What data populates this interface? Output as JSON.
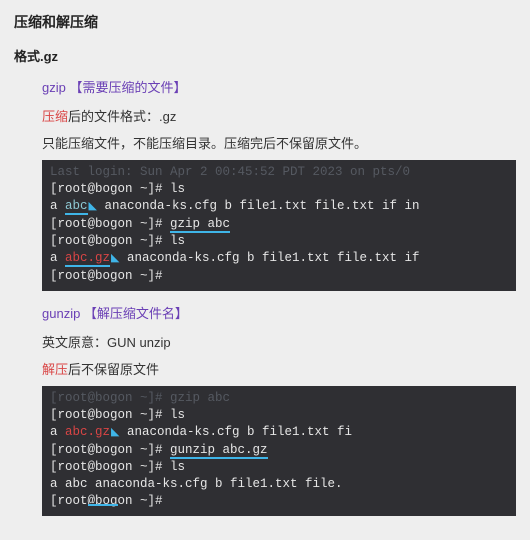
{
  "title": "压缩和解压缩",
  "section": {
    "heading": "格式.gz",
    "gzip": {
      "cmd": "gzip 【需要压缩的文件】",
      "after_label_red": "压缩",
      "after_label_rest": "后的文件格式：.gz",
      "note": "只能压缩文件，不能压缩目录。压缩完后不保留原文件。"
    },
    "term1": {
      "l0": "Last login: Sun Apr  2 00:45:52 PDT 2023 on pts/0",
      "l1a": "[root@bogon ~]# ls",
      "l2_a": "a  ",
      "l2_abc": "abc",
      "l2_rest": "  anaconda-ks.cfg  b  file1.txt  file.txt  if  in",
      "l3_pre": "[root@bogon ~]# ",
      "l3_cmd": "gzip abc",
      "l4": "[root@bogon ~]# ls",
      "l5_a": "a  ",
      "l5_abc": "abc.gz",
      "l5_rest": "  anaconda-ks.cfg  b  file1.txt  file.txt  if",
      "l6": "[root@bogon ~]#"
    },
    "gunzip": {
      "cmd": "gunzip 【解压缩文件名】",
      "origin": "英文原意：GUN unzip",
      "after_label_red": "解压",
      "after_label_rest": "后不保留原文件"
    },
    "term2": {
      "l0": "[root@bogon ~]# gzip abc",
      "l1": "[root@bogon ~]# ls",
      "l2_a": "a  ",
      "l2_abc": "abc.gz",
      "l2_rest": "  anaconda-ks.cfg  b  file1.txt  fi",
      "l3_pre": "[root@bogon ~]# ",
      "l3_cmd": "gunzip abc.gz",
      "l4": "[root@bogon ~]# ls",
      "l5": "a  abc  anaconda-ks.cfg  b  file1.txt  file.",
      "l6": "[root@bogon ~]#"
    }
  }
}
